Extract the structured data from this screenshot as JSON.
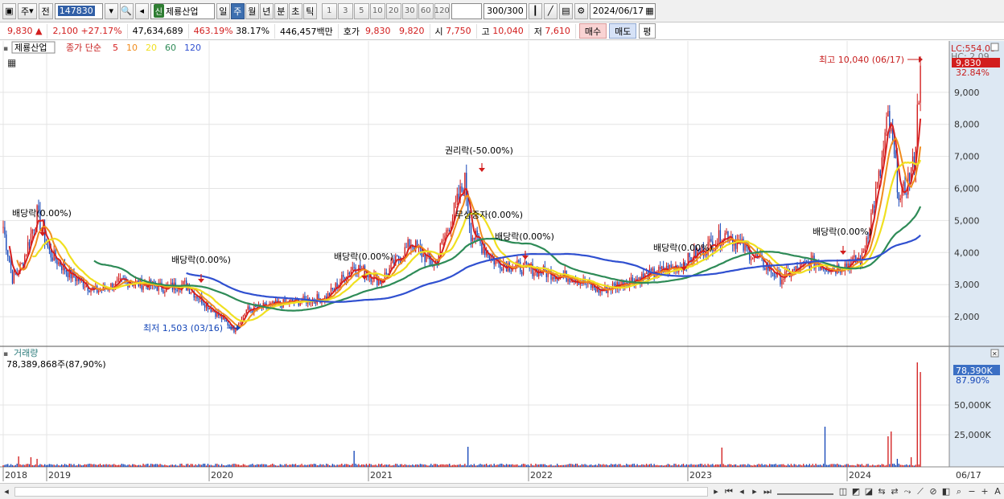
{
  "toolbar": {
    "period_select": "주",
    "prev_label": "전",
    "stock_code": "147830",
    "new_badge": "신",
    "stock_name": "제룡산업",
    "tabs": [
      {
        "label": "일",
        "active": false
      },
      {
        "label": "주",
        "active": true
      },
      {
        "label": "월",
        "active": false
      },
      {
        "label": "년",
        "active": false
      },
      {
        "label": "분",
        "active": false
      },
      {
        "label": "초",
        "active": false
      },
      {
        "label": "틱",
        "active": false
      }
    ],
    "intervals": [
      "1",
      "3",
      "5",
      "10",
      "20",
      "30",
      "60",
      "120"
    ],
    "count_display": "300",
    "count_total": "/300",
    "date": "2024/06/17"
  },
  "quote": {
    "price": "9,830",
    "change": "2,100",
    "change_pct": "+27.17%",
    "volume": "47,634,689",
    "vol_ratio": "463.19%",
    "turnover": "38.17%",
    "trade_value": "446,457백만",
    "ask_label": "호가",
    "ask": "9,830",
    "bid": "9,820",
    "open_label": "시",
    "open": "7,750",
    "high_label": "고",
    "high": "10,040",
    "low_label": "저",
    "low": "7,610",
    "buy_label": "매수",
    "sell_label": "매도",
    "eval_label": "평",
    "colors": {
      "up": "#d21d1d",
      "down": "#1446b8"
    }
  },
  "legend": {
    "stock_name": "제룡산업",
    "ma_prefix": "종가 단순",
    "ma_periods": [
      {
        "label": "5",
        "color": "#d62020"
      },
      {
        "label": "10",
        "color": "#f08c1e"
      },
      {
        "label": "20",
        "color": "#f0e020"
      },
      {
        "label": "60",
        "color": "#2e8b57"
      },
      {
        "label": "120",
        "color": "#3050d0"
      }
    ]
  },
  "right_info": {
    "lc": "LC:554.03",
    "hc": "HC: 2.09",
    "price_tag": "9,830",
    "pct_tag": "32.84%",
    "vol_tag": "78,390K",
    "vol_pct": "87.90%"
  },
  "annotations": {
    "high": "최고 10,040 (06/17)",
    "low": "최저 1,503 (03/16)",
    "rights": "권리락(-50.00%)",
    "bonus": "무상증자(0.00%)",
    "div": "배당락(0.00%)"
  },
  "volume_panel": {
    "title": "거래량",
    "value": "78,389,868주(87,90%)"
  },
  "x_axis": {
    "years": [
      "2018",
      "2019",
      "2020",
      "2021",
      "2022",
      "2023",
      "2024"
    ],
    "end_label": "06/17"
  },
  "chart_data": {
    "type": "candlestick",
    "period": "weekly",
    "y_ticks": [
      2000,
      3000,
      4000,
      5000,
      6000,
      7000,
      8000,
      9000
    ],
    "ylim": [
      1200,
      10400
    ],
    "volume_ticks": [
      25000,
      50000
    ],
    "volume_unit": "K",
    "ranges": {
      "high": 10040,
      "low": 1503,
      "last_close": 9830
    },
    "ma_periods": [
      5,
      10,
      20,
      60,
      120
    ],
    "close_path_weekly": [
      [
        0,
        4800
      ],
      [
        6,
        3200
      ],
      [
        12,
        3600
      ],
      [
        22,
        5200
      ],
      [
        30,
        4000
      ],
      [
        44,
        3300
      ],
      [
        60,
        2800
      ],
      [
        80,
        3100
      ],
      [
        105,
        2900
      ],
      [
        118,
        3000
      ],
      [
        150,
        1600
      ],
      [
        158,
        2200
      ],
      [
        180,
        2400
      ],
      [
        210,
        2600
      ],
      [
        228,
        3600
      ],
      [
        245,
        3100
      ],
      [
        265,
        4300
      ],
      [
        280,
        3600
      ],
      [
        300,
        6200
      ],
      [
        304,
        4600
      ],
      [
        320,
        3700
      ],
      [
        340,
        3500
      ],
      [
        372,
        3200
      ],
      [
        388,
        2800
      ],
      [
        405,
        3100
      ],
      [
        420,
        3300
      ],
      [
        440,
        3600
      ],
      [
        470,
        4600
      ],
      [
        485,
        4000
      ],
      [
        505,
        3200
      ],
      [
        525,
        3700
      ],
      [
        540,
        3500
      ],
      [
        558,
        3800
      ],
      [
        570,
        6500
      ],
      [
        575,
        8200
      ],
      [
        583,
        5600
      ],
      [
        592,
        6800
      ],
      [
        596,
        9830
      ]
    ]
  }
}
